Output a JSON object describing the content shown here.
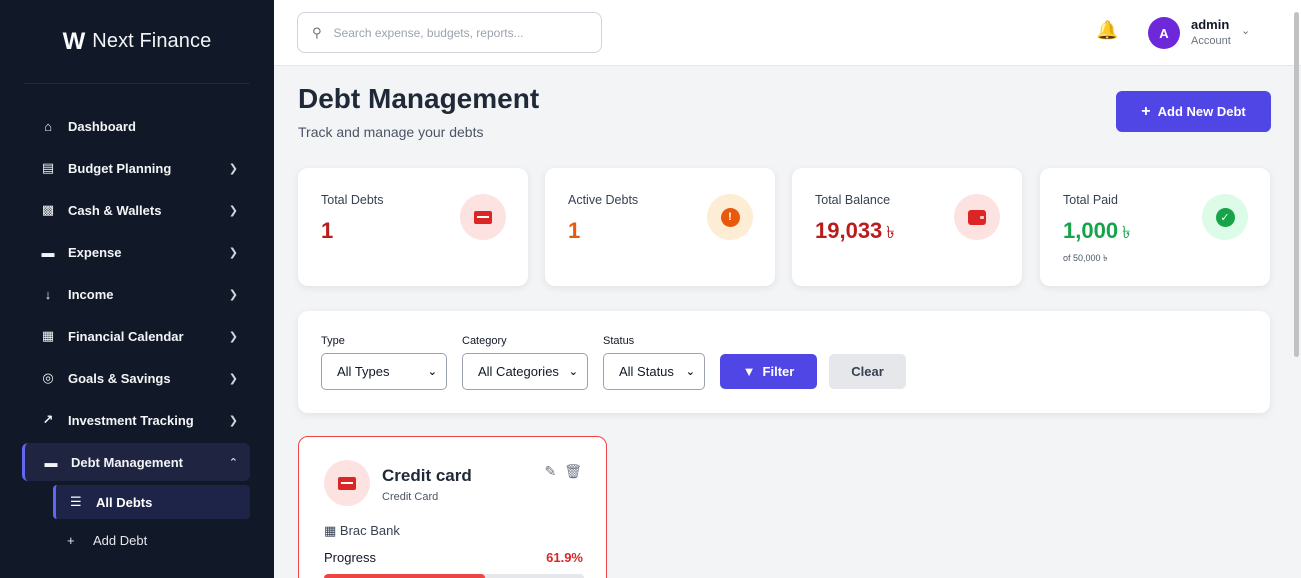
{
  "brand": {
    "name": "Next Finance"
  },
  "sidebar": {
    "items": [
      {
        "label": "Dashboard",
        "icon": "home-icon",
        "has_chevron": false
      },
      {
        "label": "Budget Planning",
        "icon": "wallet-icon",
        "has_chevron": true
      },
      {
        "label": "Cash & Wallets",
        "icon": "money-icon",
        "has_chevron": true
      },
      {
        "label": "Expense",
        "icon": "credit-card-icon",
        "has_chevron": true
      },
      {
        "label": "Income",
        "icon": "arrow-down-icon",
        "has_chevron": true
      },
      {
        "label": "Financial Calendar",
        "icon": "calendar-icon",
        "has_chevron": true
      },
      {
        "label": "Goals & Savings",
        "icon": "target-icon",
        "has_chevron": true
      },
      {
        "label": "Investment Tracking",
        "icon": "chart-line-icon",
        "has_chevron": true
      },
      {
        "label": "Debt Management",
        "icon": "credit-card-icon",
        "has_chevron": true,
        "expanded": true,
        "active": true
      }
    ],
    "subitems": [
      {
        "label": "All Debts",
        "icon": "list-icon",
        "active": true
      },
      {
        "label": "Add Debt",
        "icon": "plus-icon",
        "active": false
      }
    ]
  },
  "search": {
    "placeholder": "Search expense, budgets, reports..."
  },
  "user": {
    "initial": "A",
    "name": "admin",
    "role": "Account"
  },
  "page": {
    "title": "Debt Management",
    "subtitle": "Track and manage your debts",
    "add_button": "Add New Debt"
  },
  "stats": [
    {
      "label": "Total Debts",
      "value": "1",
      "currency": "",
      "note": "",
      "color": "#b91c1c",
      "icon": "credit-card-icon"
    },
    {
      "label": "Active Debts",
      "value": "1",
      "currency": "",
      "note": "",
      "color": "#ea580c",
      "icon": "exclamation-circle-icon"
    },
    {
      "label": "Total Balance",
      "value": "19,033",
      "currency": "৳",
      "note": "",
      "color": "#b91c1c",
      "icon": "wallet-icon"
    },
    {
      "label": "Total Paid",
      "value": "1,000",
      "currency": "৳",
      "note": "of 50,000 ৳",
      "color": "#16a34a",
      "icon": "check-circle-icon"
    }
  ],
  "filters": {
    "type": {
      "label": "Type",
      "selected": "All Types"
    },
    "category": {
      "label": "Category",
      "selected": "All Categories"
    },
    "status": {
      "label": "Status",
      "selected": "All Status"
    },
    "filter_button": "Filter",
    "clear_button": "Clear"
  },
  "debts": [
    {
      "name": "Credit card",
      "type": "Credit Card",
      "lender": "Brac Bank",
      "progress_label": "Progress",
      "progress_text": "61.9%",
      "progress": 0.619
    }
  ],
  "colors": {
    "sidebar_bg": "#111827",
    "accent": "#4f46e5",
    "danger": "#dc2626",
    "warning": "#ea580c",
    "success": "#16a34a"
  }
}
